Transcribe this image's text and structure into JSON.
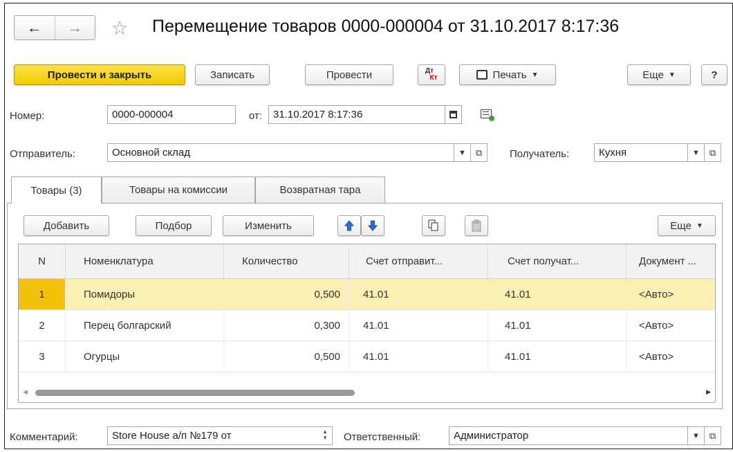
{
  "window": {
    "title": "Перемещение товаров 0000-000004 от 31.10.2017 8:17:36",
    "back_icon": "arrow-left-icon",
    "forward_icon": "arrow-right-icon",
    "favorite_icon": "star-icon"
  },
  "toolbar": {
    "post_and_close": "Провести и закрыть",
    "write": "Записать",
    "post": "Провести",
    "dtkt_top": "Дт",
    "dtkt_bottom": "Кт",
    "print": "Печать",
    "more": "Еще",
    "help": "?"
  },
  "header": {
    "number_label": "Номер:",
    "number_value": "0000-000004",
    "date_label": "от:",
    "date_value": "31.10.2017  8:17:36",
    "sender_label": "Отправитель:",
    "sender_value": "Основной склад",
    "recipient_label": "Получатель:",
    "recipient_value": "Кухня"
  },
  "tabs": [
    {
      "label": "Товары (3)"
    },
    {
      "label": "Товары на комиссии"
    },
    {
      "label": "Возвратная тара"
    }
  ],
  "table_toolbar": {
    "add": "Добавить",
    "pick": "Подбор",
    "change": "Изменить",
    "more": "Еще"
  },
  "table": {
    "columns": [
      "N",
      "Номенклатура",
      "Количество",
      "Счет отправит...",
      "Счет получат...",
      "Документ ..."
    ],
    "rows": [
      [
        "1",
        "Помидоры",
        "0,500",
        "41.01",
        "41.01",
        "<Авто>"
      ],
      [
        "2",
        "Перец болгарский",
        "0,300",
        "41.01",
        "41.01",
        "<Авто>"
      ],
      [
        "3",
        "Огурцы",
        "0,500",
        "41.01",
        "41.01",
        "<Авто>"
      ]
    ],
    "selected_row": 0
  },
  "footer": {
    "comment_label": "Комментарий:",
    "comment_value": "Store House а/п №179 от",
    "responsible_label": "Ответственный:",
    "responsible_value": "Администратор"
  },
  "colors": {
    "primary_button": "#f3c900",
    "selected_row": "#fbefb3",
    "selected_row_number": "#f4c20d",
    "arrow_blue": "#2a6fd6"
  }
}
